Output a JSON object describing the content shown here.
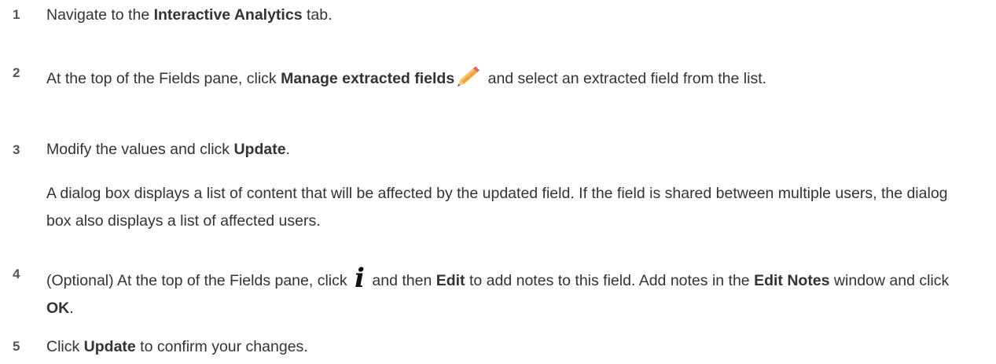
{
  "steps": [
    {
      "number": "1",
      "pre": "Navigate to the ",
      "bold1": "Interactive Analytics",
      "post": " tab."
    },
    {
      "number": "2",
      "pre": "At the top of the Fields pane, click ",
      "bold1": "Manage extracted fields",
      "icon": "pencil-icon",
      "post": " and select an extracted field from the list."
    },
    {
      "number": "3",
      "pre": "Modify the values and click ",
      "bold1": "Update",
      "post": ".",
      "note": "A dialog box displays a list of content that will be affected by the updated field. If the field is shared between multiple users, the dialog box also displays a list of affected users."
    },
    {
      "number": "4",
      "pre": "(Optional) At the top of the Fields pane, click ",
      "icon": "info-icon",
      "icon_glyph": "i",
      "mid": " and then ",
      "bold1": "Edit",
      "mid2": " to add notes to this field. Add notes in the ",
      "bold2": "Edit Notes",
      "mid3": " window and click ",
      "bold3": "OK",
      "post": "."
    },
    {
      "number": "5",
      "pre": "Click ",
      "bold1": "Update",
      "post": " to confirm your changes."
    }
  ],
  "colors": {
    "text": "#333333",
    "step_number": "#555555",
    "pencil": "#f0a030"
  }
}
